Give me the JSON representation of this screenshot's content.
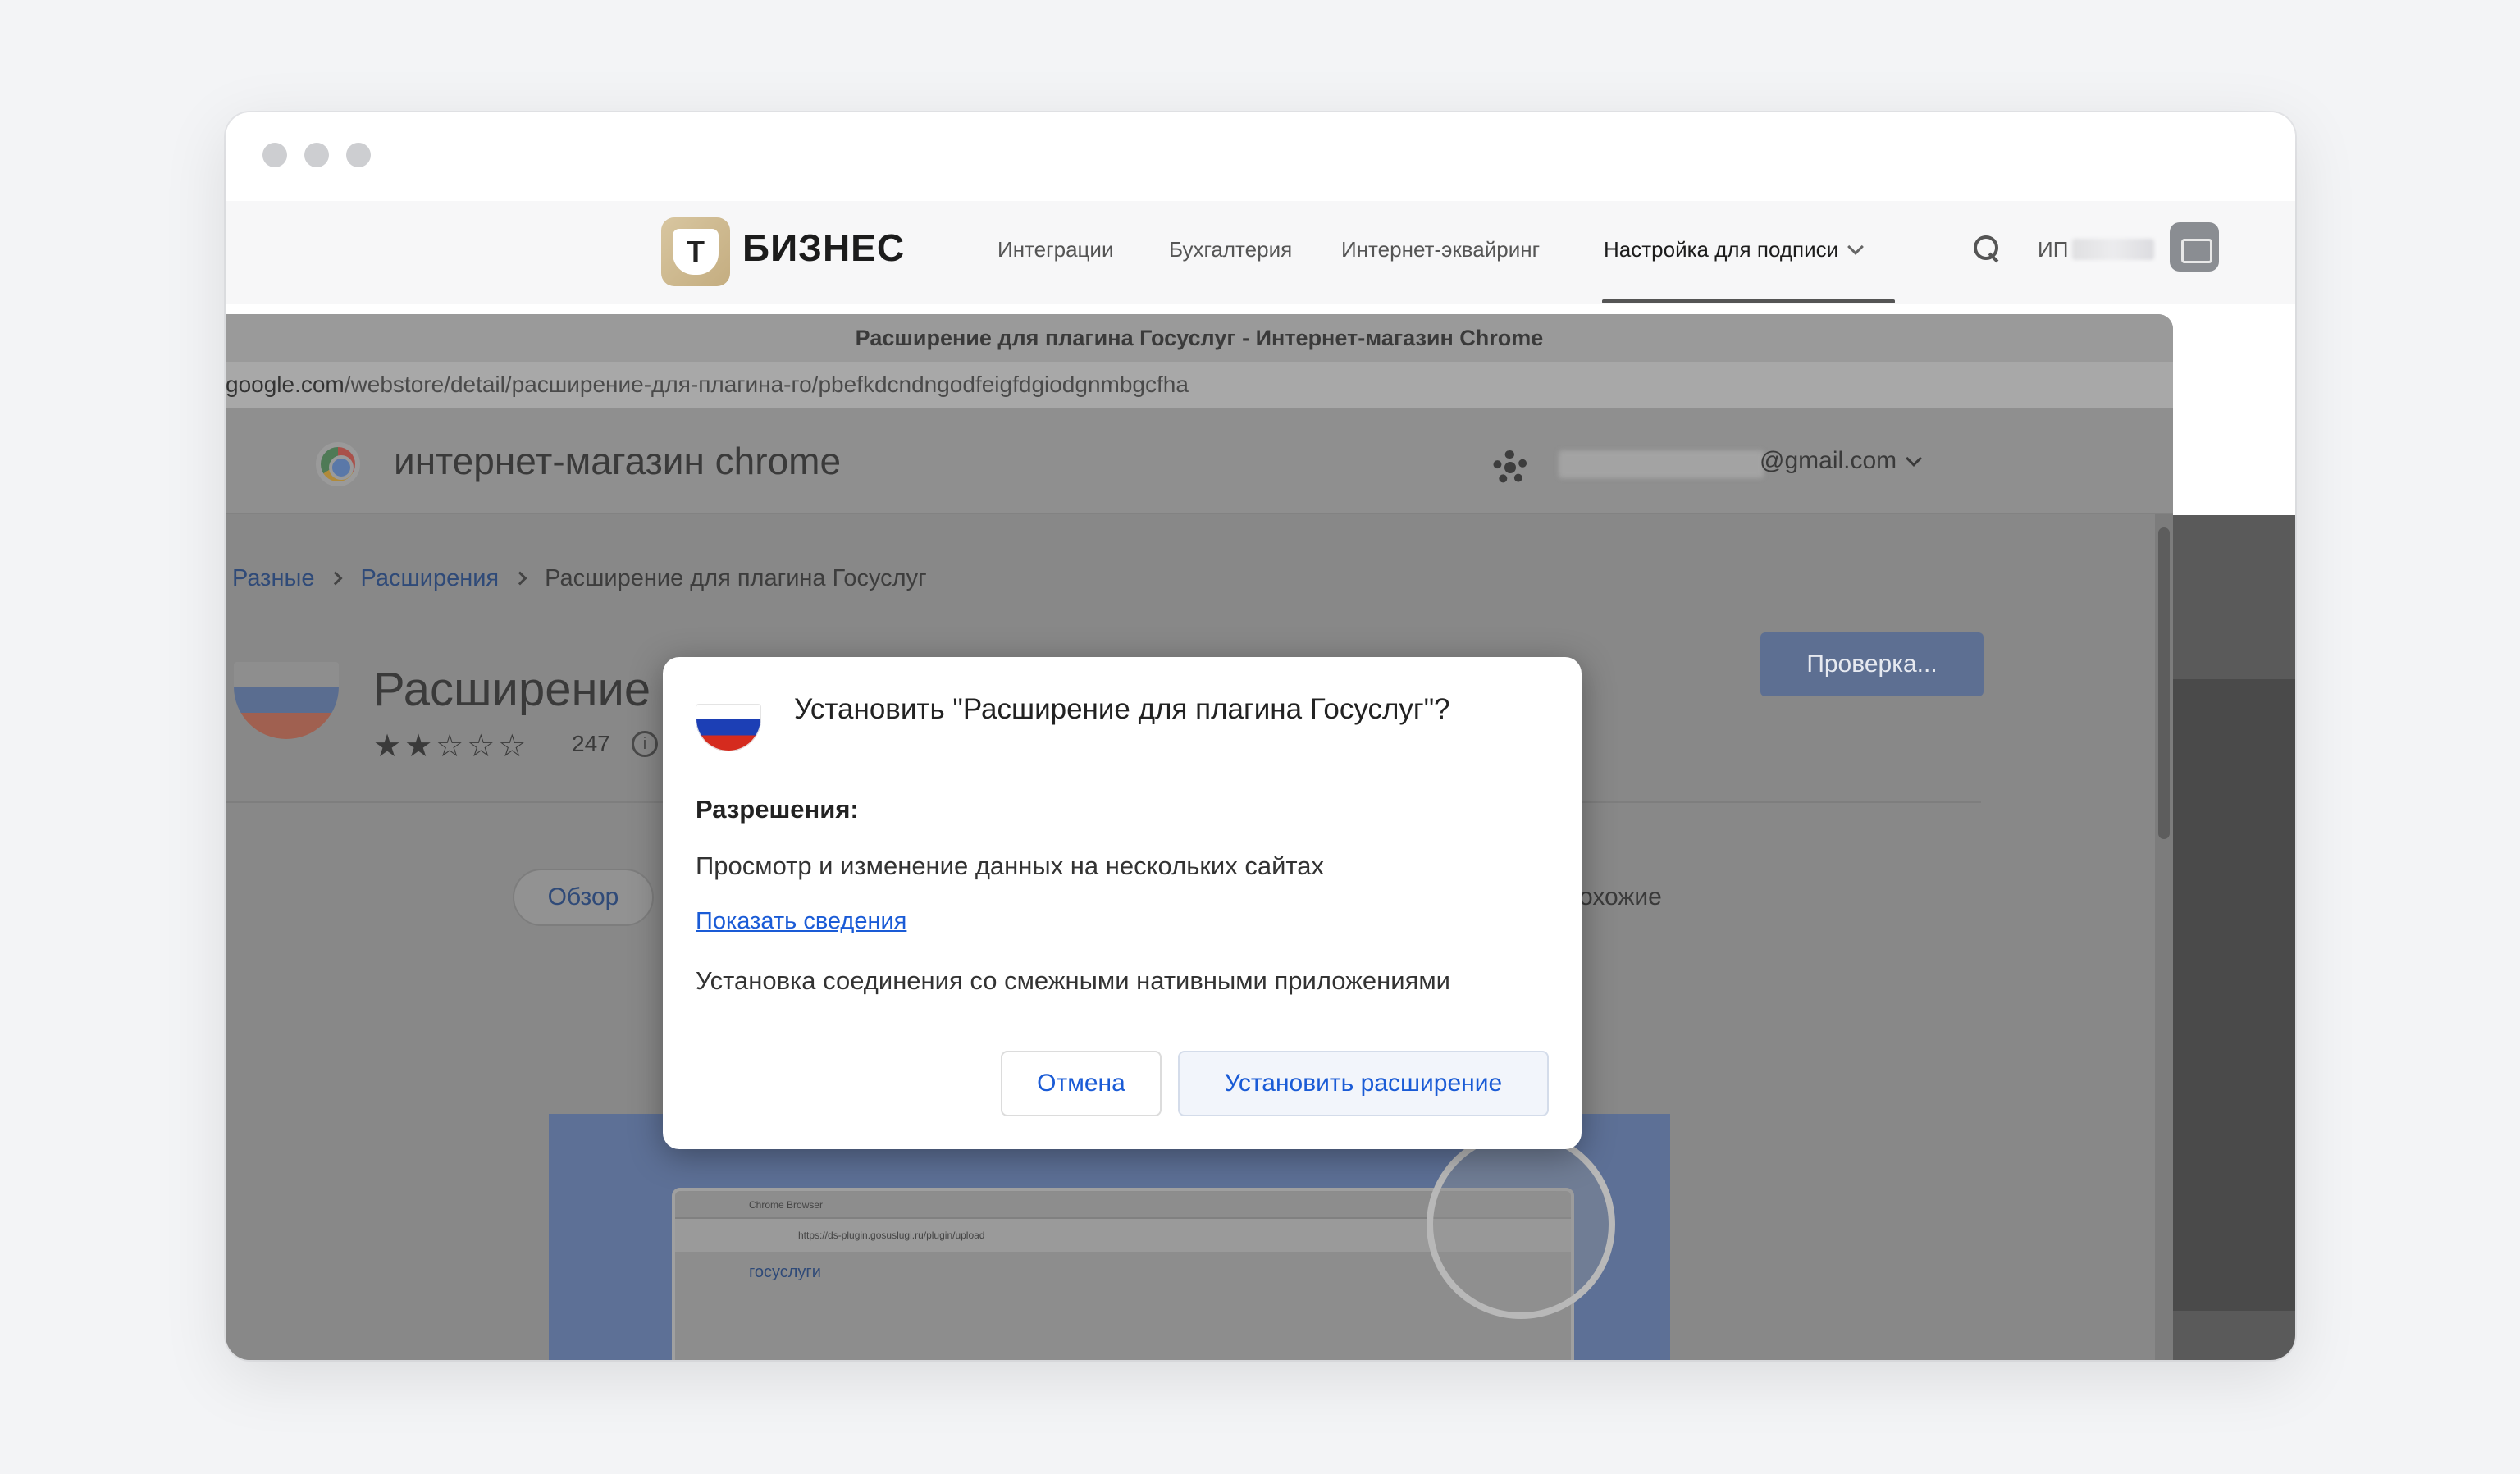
{
  "window": {
    "title": ""
  },
  "topbar": {
    "logo_letter": "Т",
    "logo_text": "БИЗНЕС",
    "nav": [
      {
        "label": "Интеграции"
      },
      {
        "label": "Бухгалтерия"
      },
      {
        "label": "Интернет-эквайринг"
      },
      {
        "label": "Настройка для подписи"
      }
    ],
    "user_prefix": "ИП"
  },
  "chrome": {
    "window_title": "Расширение для плагина Госуслуг - Интернет-магазин Chrome",
    "url_host": "google.com",
    "url_path": "/webstore/detail/расширение-для-плагина-го/pbefkdcndngodfeigfdgiodgnmbgcfha",
    "store_title": "интернет-магазин chrome",
    "account_email": "@gmail.com"
  },
  "page": {
    "breadcrumb": [
      "Разные",
      "Расширения",
      "Расширение для плагина Госуслуг"
    ],
    "ext_name": "Расширение",
    "stars": "★★☆☆☆",
    "rating_count": "247",
    "check_button": "Проверка...",
    "tab_overview": "Обзор",
    "tab_similar": "охожие",
    "preview": {
      "tab_text": "Chrome Browser",
      "url_text": "https://ds-plugin.gosuslugi.ru/plugin/upload",
      "logo": "госуслуги"
    }
  },
  "dialog": {
    "title": "Установить \"Расширение для плагина Госуслуг\"?",
    "permissions_heading": "Разрешения:",
    "permission_1": "Просмотр и изменение данных на нескольких сайтах",
    "details_link": "Показать сведения",
    "permission_2": "Установка соединения со смежными нативными приложениями",
    "cancel": "Отмена",
    "install": "Установить расширение"
  },
  "colors": {
    "accent_link": "#1a5bd6",
    "dimmed_link": "#2f4a78",
    "flag_blue": "#1c3fb5",
    "flag_red": "#d52b1e"
  }
}
